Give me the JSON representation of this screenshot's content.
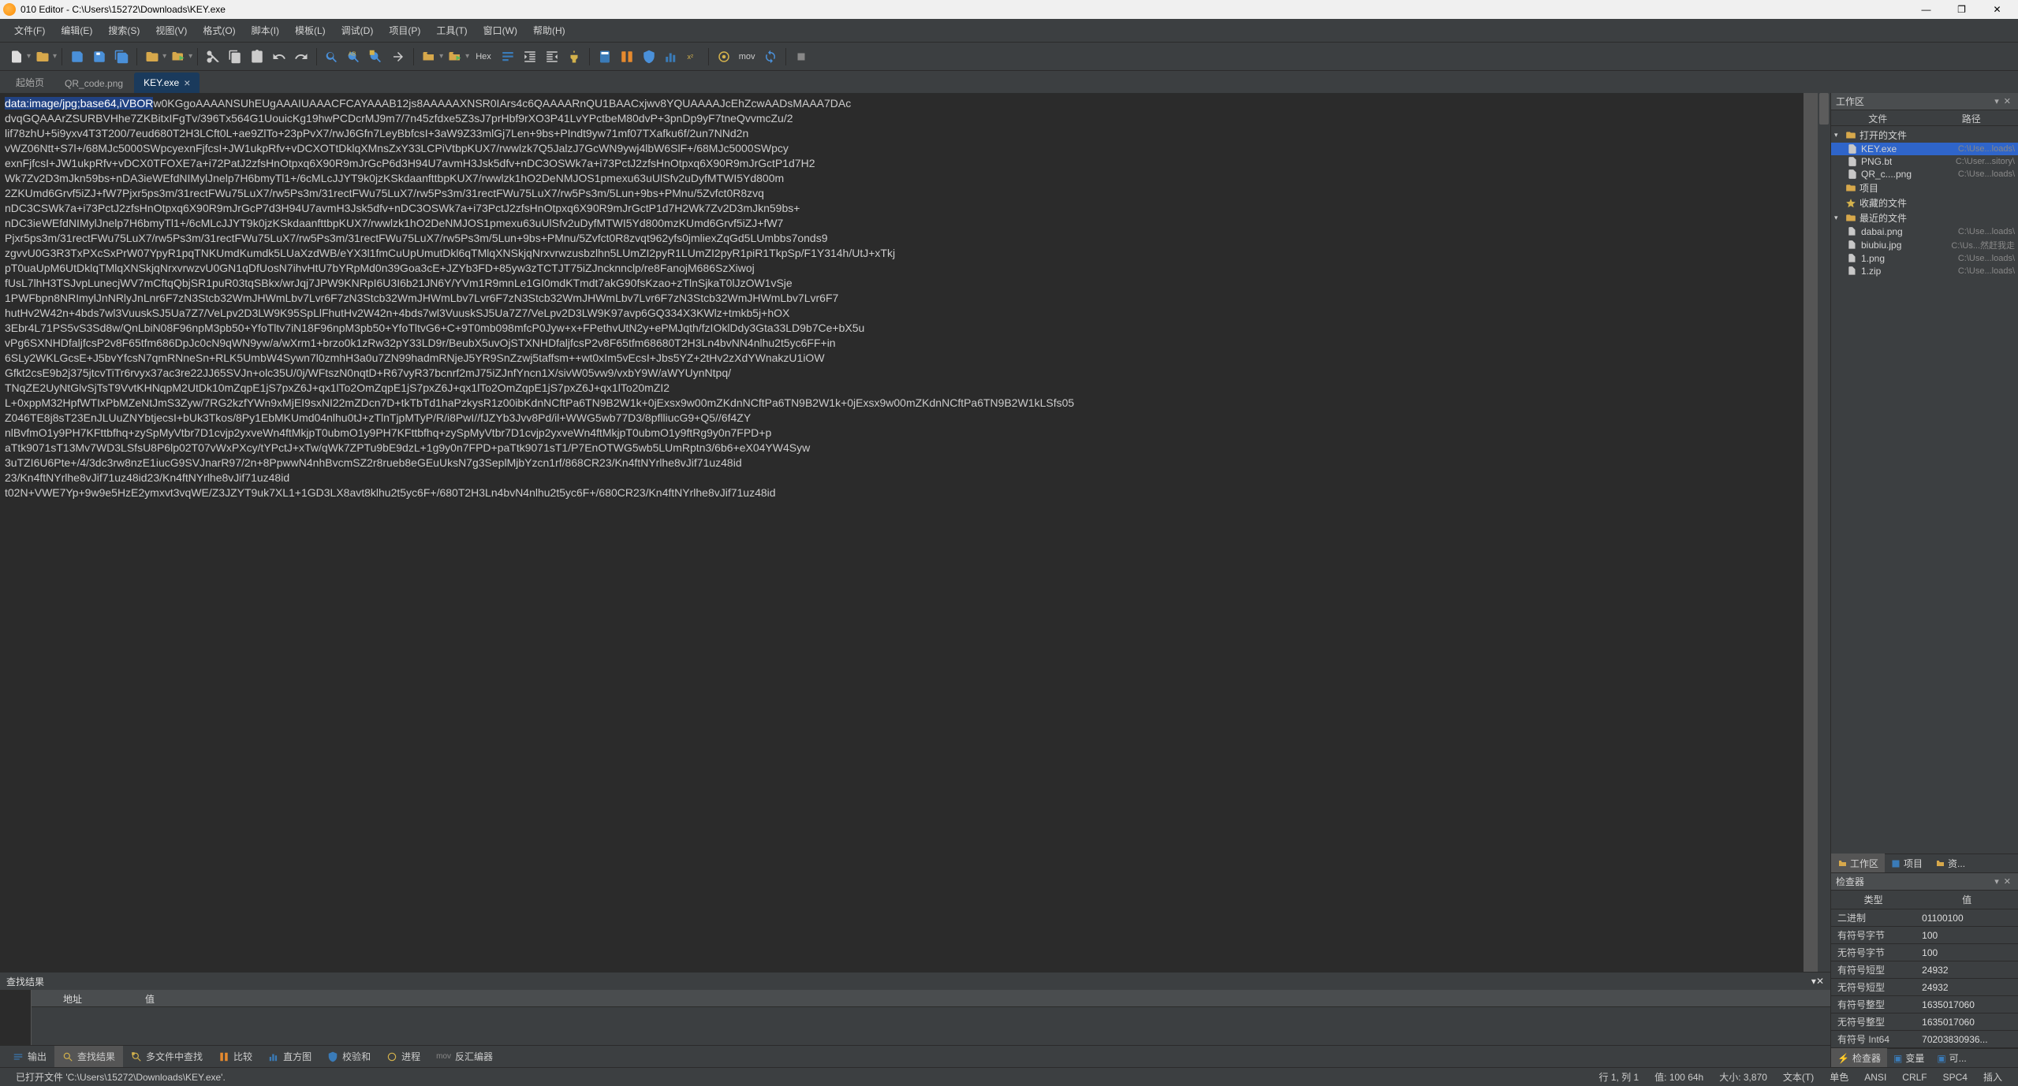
{
  "window": {
    "title": "010 Editor - C:\\Users\\15272\\Downloads\\KEY.exe"
  },
  "menu": [
    "文件(F)",
    "编辑(E)",
    "搜索(S)",
    "视图(V)",
    "格式(O)",
    "脚本(I)",
    "模板(L)",
    "调试(D)",
    "项目(P)",
    "工具(T)",
    "窗口(W)",
    "帮助(H)"
  ],
  "tabs": {
    "start": "起始页",
    "items": [
      {
        "label": "QR_code.png",
        "active": false
      },
      {
        "label": "KEY.exe",
        "active": true
      }
    ]
  },
  "toolbar_hex_label": "Hex",
  "toolbar_mov_label": "mov",
  "editor": {
    "highlight": "data:image/jpg;base64,iVBOR",
    "rest": "w0KGgoAAAANSUhEUgAAAIUAAACFCAYAAAB12js8AAAAAXNSR0IArs4c6QAAAARnQU1BAACxjwv8YQUAAAAJcEhZcwAADsMAAA7DAc\ndvqGQAAArZSURBVHhe7ZKBitxIFgTv/396Tx564G1UouicKg19hwPCDcrMJ9m7/7n45zfdxe5Z3sJ7prHbf9rXO3P41LvYPctbeM80dvP+3pnDp9yF7tneQvvmcZu/2\nlif78zhU+5i9yxv4T3T200/7eud680T2H3LCft0L+ae9ZlTo+23pPvX7/rwJ6Gfn7LeyBbfcsI+3aW9Z33mlGj7Len+9bs+PIndt9yw71mf07TXafku6f/2un7NNd2n\nvWZ06Ntt+S7l+/68MJc5000SWpcyexnFjfcsI+JW1ukpRfv+vDCXOTtDklqXMnsZxY33LCPiVtbpKUX7/rwwlzk7Q5JalzJ7GcWN9ywj4lbW6SlF+/68MJc5000SWpcy\nexnFjfcsI+JW1ukpRfv+vDCX0TFOXE7a+i72PatJ2zfsHnOtpxq6X90R9mJrGcP6d3H94U7avmH3Jsk5dfv+nDC3OSWk7a+i73PctJ2zfsHnOtpxq6X90R9mJrGctP1d7H2\nWk7Zv2D3mJkn59bs+nDA3ieWEfdNIMylJnelp7H6bmyTl1+/6cMLcJJYT9k0jzKSkdaanfttbpKUX7/rwwlzk1hO2DeNMJOS1pmexu63uUlSfv2uDyfMTWI5Yd800m\n2ZKUmd6Grvf5iZJ+fW7Pjxr5ps3m/31rectFWu75LuX7/rw5Ps3m/31rectFWu75LuX7/rw5Ps3m/31rectFWu75LuX7/rw5Ps3m/5Lun+9bs+PMnu/5Zvfct0R8zvq\nnDC3CSWk7a+i73PctJ2zfsHnOtpxq6X90R9mJrGcP7d3H94U7avmH3Jsk5dfv+nDC3OSWk7a+i73PctJ2zfsHnOtpxq6X90R9mJrGctP1d7H2Wk7Zv2D3mJkn59bs+\nnDC3ieWEfdNIMylJnelp7H6bmyTl1+/6cMLcJJYT9k0jzKSkdaanfttbpKUX7/rwwlzk1hO2DeNMJOS1pmexu63uUlSfv2uDyfMTWI5Yd800mzKUmd6Grvf5iZJ+fW7\nPjxr5ps3m/31rectFWu75LuX7/rw5Ps3m/31rectFWu75LuX7/rw5Ps3m/31rectFWu75LuX7/rw5Ps3m/5Lun+9bs+PMnu/5Zvfct0R8zvqt962yfs0jmliexZqGd5LUmbbs7onds9\nzgvvU0G3R3TxPXcSxPrW07YpyR1pqTNKUmdKumdk5LUaXzdWB/eYX3l1fmCuUpUmutDkl6qTMlqXNSkjqNrxvrwzusbzlhn5LUmZI2pyR1LUmZI2pyR1piR1TkpSp/F1Y314h/UtJ+xTkj\npT0uaUpM6UtDklqTMlqXNSkjqNrxvrwzvU0GN1qDfUosN7ihvHtU7bYRpMd0n39Goa3cE+JZYb3FD+85yw3zTCTJT75iZJncknnclp/re8FanojM686SzXiwoj\nfUsL7lhH3TSJvpLunecjWV7mCftqQbjSR1puR03tqSBkx/wrJqj7JPW9KNRpI6U3I6b21JN6Y/YVm1R9mnLe1GI0mdKTmdt7akG90fsKzao+zTlnSjkaT0lJzOW1vSje\n1PWFbpn8NRImylJnNRlyJnLnr6F7zN3Stcb32WmJHWmLbv7Lvr6F7zN3Stcb32WmJHWmLbv7Lvr6F7zN3Stcb32WmJHWmLbv7Lvr6F7zN3Stcb32WmJHWmLbv7Lvr6F7\nhutHv2W42n+4bds7wl3VuuskSJ5Ua7Z7/VeLpv2D3LW9K95SpLlFhutHv2W42n+4bds7wl3VuuskSJ5Ua7Z7/VeLpv2D3LW9K97avp6GQ334X3KWlz+tmkb5j+hOX\n3Ebr4L71PS5vS3Sd8w/QnLbiN08F96npM3pb50+YfoTltv7iN18F96npM3pb50+YfoTltvG6+C+9T0mb098mfcP0Jyw+x+FPethvUtN2y+ePMJqth/fzIOklDdy3Gta33LD9b7Ce+bX5u\nvPg6SXNHDfaljfcsP2v8F65tfm686DpJc0cN9qWN9yw/a/wXrm1+brzo0k1zRw32pY33LD9r/BeubX5uvOjSTXNHDfaljfcsP2v8F65tfm68680T2H3Ln4bvNN4nlhu2t5yc6FF+in\n6SLy2WKLGcsE+J5bvYfcsN7qmRNneSn+RLK5UmbW4Sywn7l0zmhH3a0u7ZN99hadmRNjeJ5YR9SnZzwj5taffsm++wt0xIm5vEcsI+Jbs5YZ+2tHv2zXdYWnakzU1iOW\nGfkt2csE9b2j375jtcvTiTr6rvyx37ac3re22JJ65SVJn+olc35U/0j/WFtszN0nqtD+R67vyR37bcnrf2mJ75iZJnfYncn1X/sivW05vw9/vxbY9W/aWYUynNtpq/\nTNqZE2UyNtGlvSjTsT9VvtKHNqpM2UtDk10mZqpE1jS7pxZ6J+qx1lTo2OmZqpE1jS7pxZ6J+qx1lTo2OmZqpE1jS7pxZ6J+qx1lTo20mZI2\nL+0xppM32HpfWTIxPbMZeNtJmS3Zyw/7RG2kzfYWn9xMjEI9sxNI22mZDcn7D+tkTbTd1haPzkysR1z00ibKdnNCftPa6TN9B2W1k+0jExsx9w00mZKdnNCftPa6TN9B2W1k+0jExsx9w00mZKdnNCftPa6TN9B2W1kLSfs05\nZ046TE8j8sT23EnJLUuZNYbtjecsI+bUk3Tkos/8Py1EbMKUmd04nlhu0tJ+zTlnTjpMTyP/R/i8PwI//fJZYb3Jvv8Pd/il+WWG5wb77D3/8pflliucG9+Q5//6f4ZY\nnlBvfmO1y9PH7KFttbfhq+zySpMyVtbr7D1cvjp2yxveWn4ftMkjpT0ubmO1y9PH7KFttbfhq+zySpMyVtbr7D1cvjp2yxveWn4ftMkjpT0ubmO1y9ftRg9y0n7FPD+p\naTtk9071sT13Mv7WD3LSfsU8P6lp02T07vWxPXcy/tYPctJ+xTw/qWk7ZPTu9bE9dzL+1g9y0n7FPD+paTtk9071sT1/P7EnOTWG5wb5LUmRptn3/6b6+eX04YW4Syw\n3uTZI6U6Pte+/4/3dc3rw8nzE1iucG9SVJnarR97/2n+8PpwwN4nhBvcmSZ2r8rueb8eGEuUksN7g3SeplMjbYzcn1rf/868CR23/Kn4ftNYrlhe8vJif71uz48id\n23/Kn4ftNYrlhe8vJif71uz48id23/Kn4ftNYrlhe8vJif71uz48id\nt02N+VWE7Yp+9w9e5HzE2ymxvt3vqWE/Z3JZYT9uk7XL1+1GD3LX8avt8klhu2t5yc6F+/680T2H3Ln4bvN4nlhu2t5yc6F+/680CR23/Kn4ftNYrlhe8vJif71uz48id"
  },
  "workspace": {
    "title": "工作区",
    "col_file": "文件",
    "col_path": "路径",
    "groups": {
      "open": "打开的文件",
      "project": "项目",
      "favorites": "收藏的文件",
      "recent": "最近的文件"
    },
    "open_files": [
      {
        "name": "KEY.exe",
        "path": "C:\\Use...loads\\"
      },
      {
        "name": "PNG.bt",
        "path": "C:\\User...sitory\\"
      },
      {
        "name": "QR_c....png",
        "path": "C:\\Use...loads\\"
      }
    ],
    "recent_files": [
      {
        "name": "dabai.png",
        "path": "C:\\Use...loads\\"
      },
      {
        "name": "biubiu.jpg",
        "path": "C:\\Us...然赶我走"
      },
      {
        "name": "1.png",
        "path": "C:\\Use...loads\\"
      },
      {
        "name": "1.zip",
        "path": "C:\\Use...loads\\"
      }
    ],
    "tabs": {
      "workspace": "工作区",
      "project": "项目",
      "resources": "资..."
    }
  },
  "inspector": {
    "title": "检查器",
    "col_type": "类型",
    "col_value": "值",
    "rows": [
      {
        "t": "二进制",
        "v": "01100100"
      },
      {
        "t": "有符号字节",
        "v": "100"
      },
      {
        "t": "无符号字节",
        "v": "100"
      },
      {
        "t": "有符号短型",
        "v": "24932"
      },
      {
        "t": "无符号短型",
        "v": "24932"
      },
      {
        "t": "有符号整型",
        "v": "1635017060"
      },
      {
        "t": "无符号整型",
        "v": "1635017060"
      },
      {
        "t": "有符号 Int64",
        "v": "70203830936..."
      }
    ],
    "tabs": {
      "inspector": "检查器",
      "vars": "变量",
      "bookmarks": "可..."
    }
  },
  "search": {
    "title": "查找结果",
    "col_addr": "地址",
    "col_value": "值"
  },
  "bottom_tabs": {
    "output": "输出",
    "search_results": "查找结果",
    "multi_search": "多文件中查找",
    "compare": "比较",
    "histogram": "直方图",
    "checksum": "校验和",
    "process": "进程",
    "disasm": "反汇编器",
    "disasm_prefix": "mov"
  },
  "statusbar": {
    "file_opened": "已打开文件 'C:\\Users\\15272\\Downloads\\KEY.exe'.",
    "pos": "行 1, 列 1",
    "value": "值: 100 64h",
    "size": "大小: 3,870",
    "type": "文本(T)",
    "units": "单色",
    "ansi": "ANSI",
    "crlf": "CRLF",
    "spc": "SPC4",
    "ins": "插入"
  }
}
